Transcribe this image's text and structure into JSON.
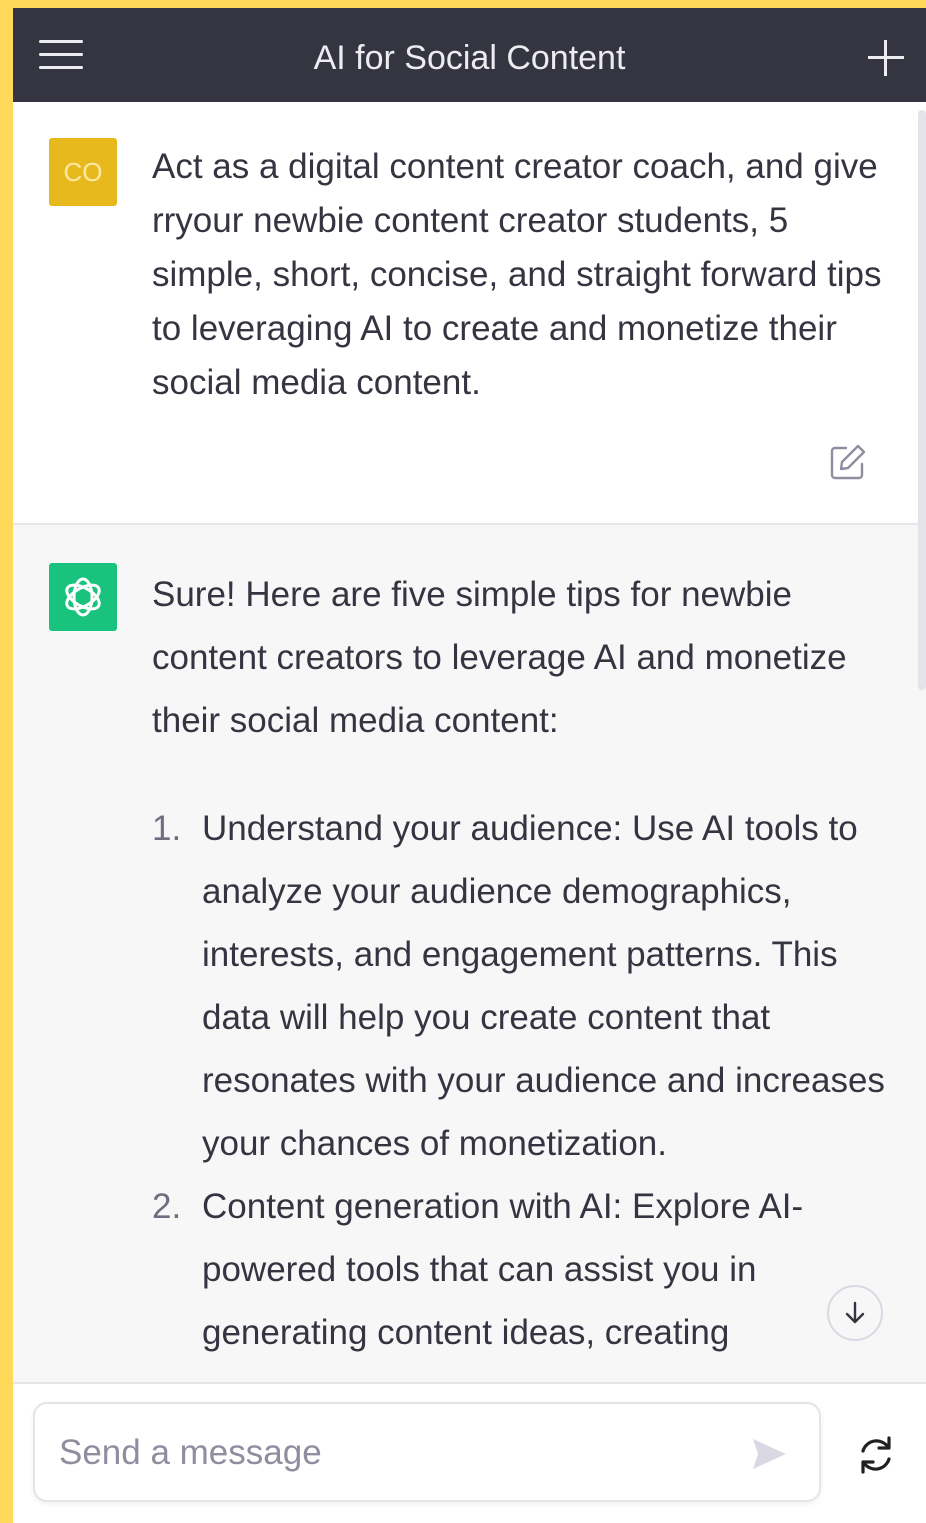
{
  "colors": {
    "frame": "#fed95a",
    "header_bg": "#343541",
    "user_avatar": "#e8b91d",
    "assistant_avatar": "#19c37d",
    "assistant_bg": "#f7f7f8"
  },
  "header": {
    "title": "AI for Social Content",
    "menu_icon": "hamburger-menu-icon",
    "new_chat_icon": "plus-icon"
  },
  "user_message": {
    "avatar_initials": "CO",
    "text": "Act as a digital content creator coach, and give rryour newbie content creator students, 5 simple, short, concise, and straight forward tips to leveraging AI to create and monetize their social media content.",
    "edit_icon": "edit-icon"
  },
  "assistant_message": {
    "intro": "Sure! Here are five simple tips for newbie content creators to leverage AI and monetize their social media content:",
    "tips": [
      {
        "number": "1.",
        "text": "Understand your audience: Use AI tools to analyze your audience demographics, interests, and engagement patterns. This data will help you create content that resonates with your audience and increases your chances of monetization."
      },
      {
        "number": "2.",
        "text": "Content generation with AI: Explore AI-powered tools that can assist you in generating content ideas, creating"
      }
    ],
    "scroll_icon": "arrow-down-icon"
  },
  "composer": {
    "placeholder": "Send a message",
    "value": "",
    "send_icon": "send-icon",
    "regenerate_icon": "regenerate-icon"
  }
}
